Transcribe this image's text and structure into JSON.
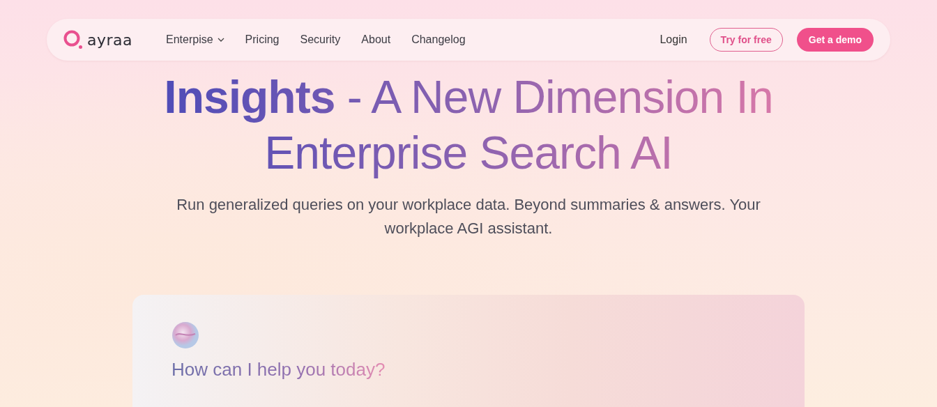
{
  "brand": {
    "name": "ayraa"
  },
  "nav": [
    {
      "label": "Enterpise",
      "dropdown": true
    },
    {
      "label": "Pricing",
      "dropdown": false
    },
    {
      "label": "Security",
      "dropdown": false
    },
    {
      "label": "About",
      "dropdown": false
    },
    {
      "label": "Changelog",
      "dropdown": false
    }
  ],
  "actions": [
    {
      "label": "Login",
      "kind": "link"
    },
    {
      "label": "Try for free",
      "kind": "outline"
    },
    {
      "label": "Get a demo",
      "kind": "primary"
    }
  ],
  "hero": {
    "title": "**Insights** - A New Dimension In Enterprise Search AI",
    "subtitle": "Run generalized queries on your workplace data. Beyond summaries & answers. Your workplace AGI assistant."
  },
  "chat_card": {
    "prompt": "How can I help you today?"
  }
}
